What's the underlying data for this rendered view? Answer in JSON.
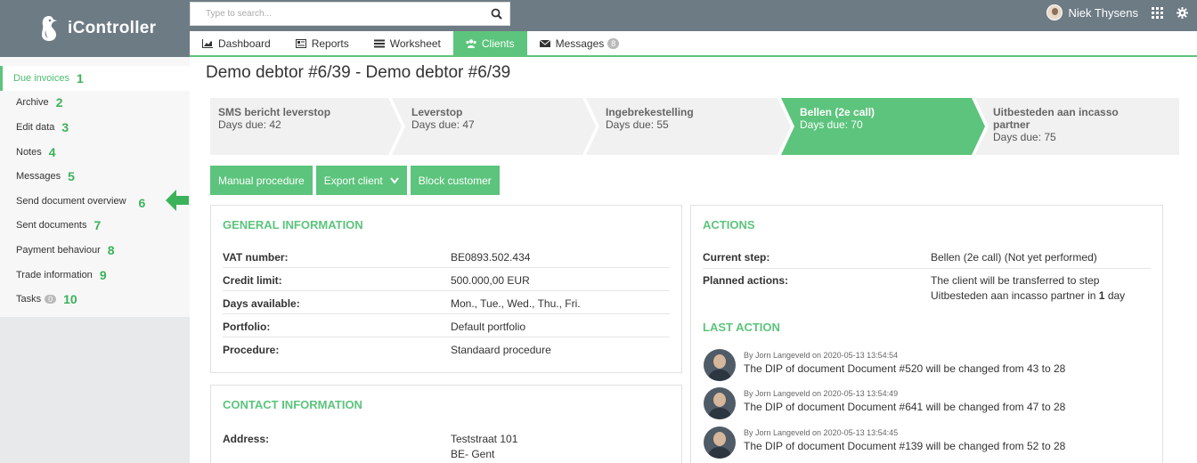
{
  "app": {
    "name": "iController"
  },
  "search": {
    "placeholder": "Type to search..."
  },
  "user": {
    "name": "Niek Thysens"
  },
  "tabs": [
    {
      "label": "Dashboard",
      "icon": "chart-icon"
    },
    {
      "label": "Reports",
      "icon": "reports-icon"
    },
    {
      "label": "Worksheet",
      "icon": "list-icon"
    },
    {
      "label": "Clients",
      "icon": "users-icon",
      "active": true
    },
    {
      "label": "Messages",
      "icon": "envelope-icon",
      "badge": "8"
    }
  ],
  "sidebar": {
    "items": [
      {
        "label": "Due invoices",
        "num": "1",
        "active": true
      },
      {
        "label": "Archive",
        "num": "2"
      },
      {
        "label": "Edit data",
        "num": "3"
      },
      {
        "label": "Notes",
        "num": "4"
      },
      {
        "label": "Messages",
        "num": "5"
      },
      {
        "label": "Send document overview",
        "num": "6"
      },
      {
        "label": "Sent documents",
        "num": "7"
      },
      {
        "label": "Payment behaviour",
        "num": "8"
      },
      {
        "label": "Trade information",
        "num": "9"
      },
      {
        "label": "Tasks",
        "num": "10",
        "badge": "0"
      }
    ]
  },
  "page": {
    "title": "Demo debtor #6/39 - Demo debtor #6/39"
  },
  "steps": [
    {
      "title": "SMS bericht leverstop",
      "days": "Days due: 42"
    },
    {
      "title": "Leverstop",
      "days": "Days due: 47"
    },
    {
      "title": "Ingebrekestelling",
      "days": "Days due: 55"
    },
    {
      "title": "Bellen (2e call)",
      "days": "Days due: 70",
      "active": true
    },
    {
      "title": "Uitbesteden aan incasso partner",
      "days": "Days due: 75"
    }
  ],
  "buttons": {
    "manual": "Manual procedure",
    "export": "Export client",
    "block": "Block customer"
  },
  "general": {
    "title": "GENERAL INFORMATION",
    "rows": [
      {
        "k": "VAT number:",
        "v": "BE0893.502.434"
      },
      {
        "k": "Credit limit:",
        "v": "500.000,00 EUR"
      },
      {
        "k": "Days available:",
        "v": "Mon., Tue., Wed., Thu., Fri."
      },
      {
        "k": "Portfolio:",
        "v": "Default portfolio"
      },
      {
        "k": "Procedure:",
        "v": "Standaard procedure"
      }
    ]
  },
  "contact": {
    "title": "CONTACT INFORMATION",
    "address_label": "Address:",
    "address_line1": "Teststraat 101",
    "address_line2": "BE- Gent"
  },
  "actions": {
    "title": "ACTIONS",
    "current_label": "Current step:",
    "current_value": "Bellen (2e call) (Not yet performed)",
    "planned_label": "Planned actions:",
    "planned_line1": "The client will be transferred to step",
    "planned_line2_pre": "Uitbesteden aan incasso partner in ",
    "planned_line2_num": "1",
    "planned_line2_post": " day"
  },
  "last_action": {
    "title": "LAST ACTION",
    "items": [
      {
        "meta": "By Jorn Langeveld on 2020-05-13 13:54:54",
        "text": "The DIP of document Document #520 will be changed from 43 to 28"
      },
      {
        "meta": "By Jorn Langeveld on 2020-05-13 13:54:49",
        "text": "The DIP of document Document #641 will be changed from 47 to 28"
      },
      {
        "meta": "By Jorn Langeveld on 2020-05-13 13:54:45",
        "text": "The DIP of document Document #139 will be changed from 52 to 28"
      }
    ]
  },
  "colors": {
    "accent": "#5cc47c",
    "topbar": "#6d7b84",
    "step_inactive": "#f1f1f1"
  }
}
